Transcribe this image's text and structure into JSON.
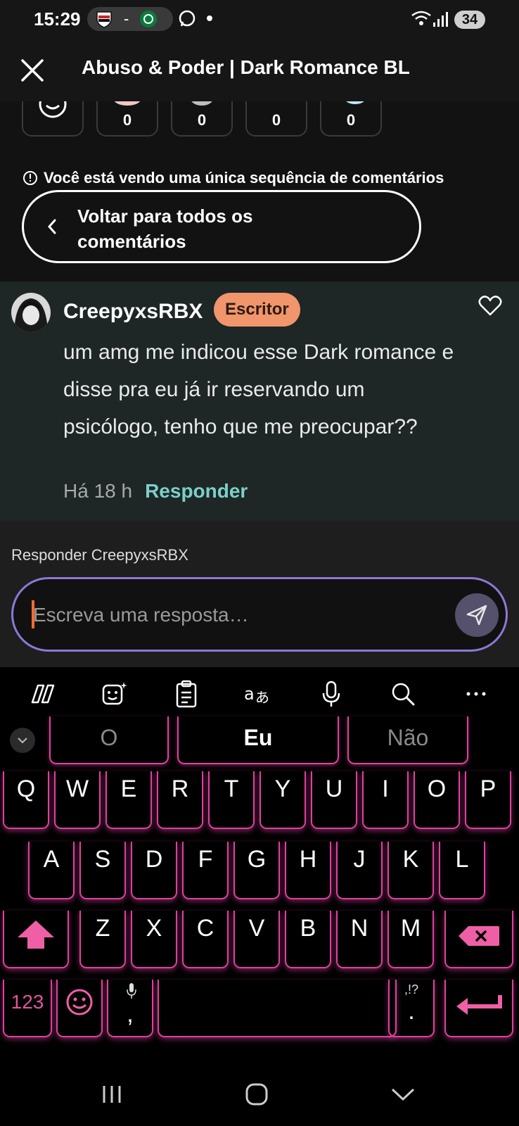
{
  "status_bar": {
    "time": "15:29",
    "separator": "-",
    "battery": "34"
  },
  "header": {
    "title": "Abuso & Poder | Dark Romance BL"
  },
  "reactions": [
    {
      "count": "0"
    },
    {
      "count": "0"
    },
    {
      "count": "0"
    },
    {
      "count": "0"
    }
  ],
  "thread_notice": "Você está vendo uma única sequência de comentários",
  "back_button_label": "Voltar para todos os comentários",
  "comment": {
    "username": "CreepyxsRBX",
    "badge": "Escritor",
    "text": "um amg me indicou esse Dark romance e disse pra eu já ir reservando um psicólogo, tenho que me preocupar??",
    "time": "Há 18 h",
    "reply_label": "Responder"
  },
  "reply": {
    "replying_to": "Responder CreepyxsRBX",
    "placeholder": "Escreva uma resposta…"
  },
  "keyboard": {
    "suggestions": [
      "O",
      "Eu",
      "Não"
    ],
    "row1": [
      "Q",
      "W",
      "E",
      "R",
      "T",
      "Y",
      "U",
      "I",
      "O",
      "P"
    ],
    "row2": [
      "A",
      "S",
      "D",
      "F",
      "G",
      "H",
      "J",
      "K",
      "L"
    ],
    "row3": [
      "Z",
      "X",
      "C",
      "V",
      "B",
      "N",
      "M"
    ],
    "numbers_label": "123",
    "comma": ",",
    "period": ".",
    "punct_hint": ",!?",
    "accent_color": "#e040a0"
  }
}
